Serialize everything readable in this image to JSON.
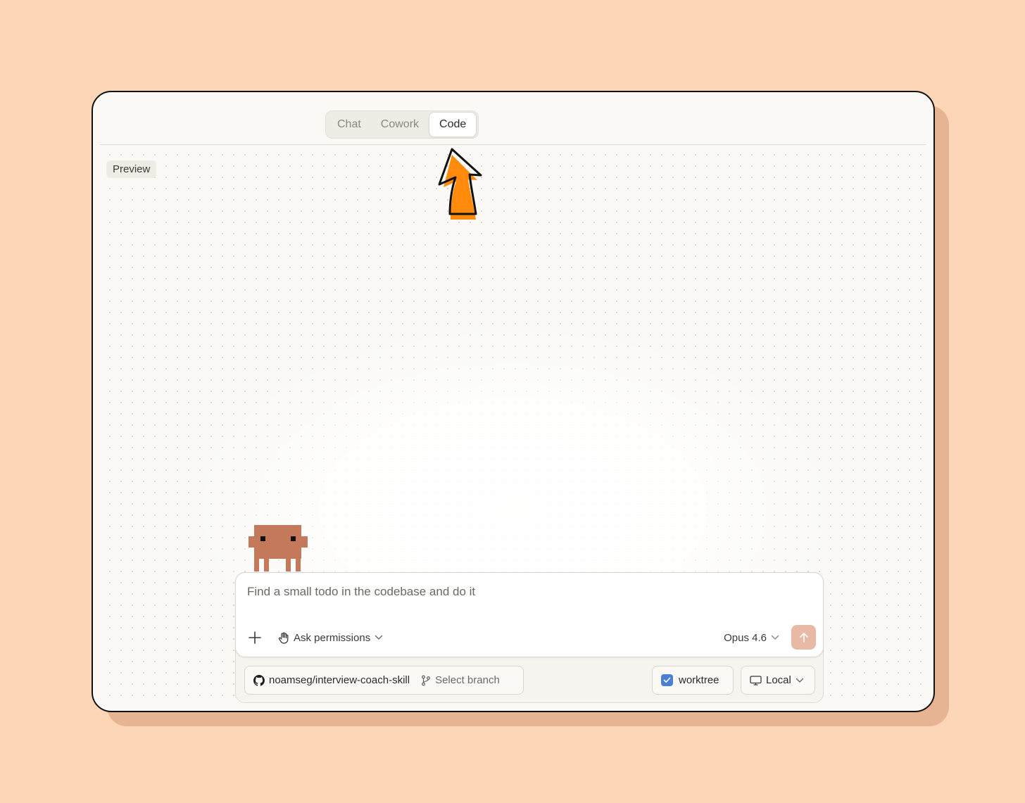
{
  "tabs": [
    {
      "label": "Chat"
    },
    {
      "label": "Cowork"
    },
    {
      "label": "Code",
      "active": true
    }
  ],
  "preview_label": "Preview",
  "composer": {
    "prompt": "Find a small todo in the codebase and do it",
    "permissions_label": "Ask permissions",
    "model_label": "Opus 4.6"
  },
  "repo": {
    "name": "noamseg/interview-coach-skill",
    "branch_label": "Select branch"
  },
  "worktree": {
    "label": "worktree",
    "checked": true
  },
  "environment": {
    "label": "Local"
  },
  "colors": {
    "background": "#fdd5b7",
    "accent_arrow": "#ff8a0c",
    "mascot": "#c47a5a",
    "send_button": "#e8b9a4",
    "checkbox": "#4a7fd6"
  },
  "icons": [
    "plus-icon",
    "hand-icon",
    "chevron-down-icon",
    "arrow-up-icon",
    "github-icon",
    "git-branch-icon",
    "check-icon",
    "monitor-icon"
  ]
}
